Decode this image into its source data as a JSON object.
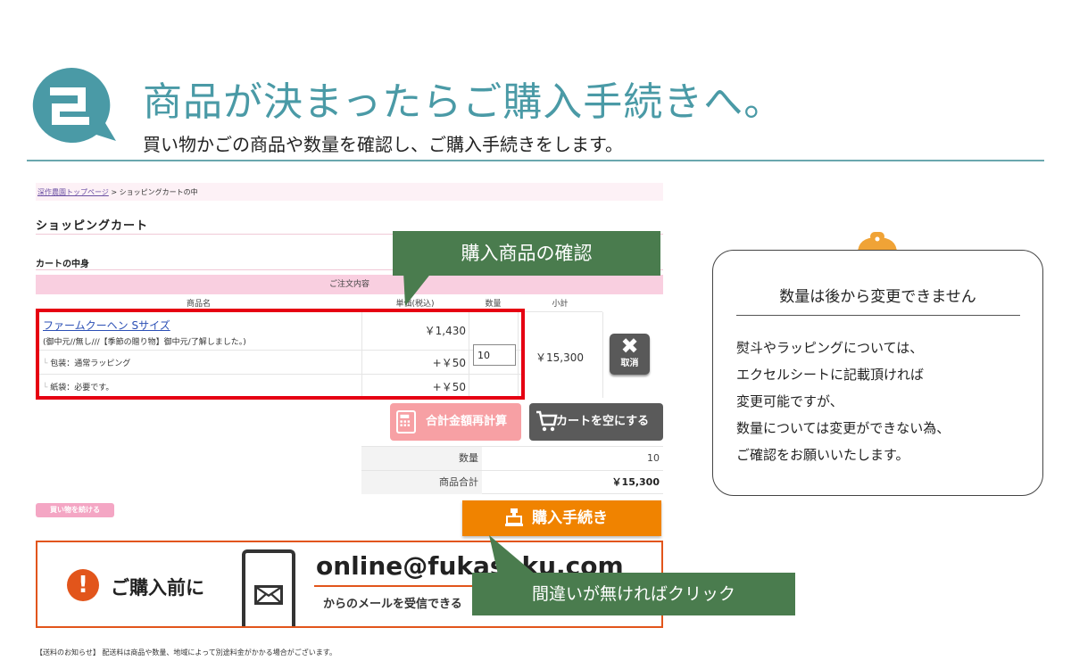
{
  "header": {
    "title": "商品が決まったらご購入手続きへ。",
    "subtitle": "買い物かごの商品や数量を確認し、ご購入手続きをします。"
  },
  "cart": {
    "breadcrumb": {
      "home": "深作農園トップページ",
      "sep": " > ",
      "current": "ショッピングカートの中"
    },
    "page_title": "ショッピングカート",
    "section_title": "カートの中身",
    "order_header": "ご注文内容",
    "columns": {
      "name": "商品名",
      "price": "単価(税込)",
      "qty": "数量",
      "subtotal": "小計"
    },
    "item": {
      "name": "ファームクーヘン Sサイズ",
      "description": "(御中元//無し///【季節の贈り物】御中元/了解しました。)",
      "price": "￥1,430",
      "quantity": "10",
      "subtotal": "￥15,300",
      "options": [
        {
          "label": "包装：通常ラッピング",
          "price": "+￥50"
        },
        {
          "label": "紙袋：必要です。",
          "price": "+￥50"
        }
      ]
    },
    "cancel": {
      "mark": "✖",
      "label": "取消"
    },
    "recalc_label": "合計金額再計算",
    "empty_label": "カートを空にする",
    "summary": {
      "qty_label": "数量",
      "qty_value": "10",
      "total_label": "商品合計",
      "total_value": "￥15,300"
    },
    "continue_label": "買い物を続ける",
    "purchase_label": "購入手続き"
  },
  "notice": {
    "mark": "!",
    "title": "ご購入前に",
    "email": "online@fukasaku.com",
    "subtext": "からのメールを受信できる"
  },
  "footnote": "【送料のお知らせ】 配送料は商品や数量、地域によって別途料金がかかる場合がございます。",
  "callouts": {
    "confirm": "購入商品の確認",
    "click": "間違いが無ければクリック"
  },
  "note": {
    "title": "数量は後から変更できません",
    "lines": [
      "熨斗やラッピングについては、",
      "エクセルシートに記載頂ければ",
      "変更可能ですが、",
      "数量については変更ができない為、",
      "ご確認をお願いいたします。"
    ]
  },
  "colors": {
    "teal": "#4a9aa6",
    "green": "#4a7c4e",
    "orange": "#f08300",
    "red": "#e60012",
    "pink": "#f9cfe0"
  }
}
